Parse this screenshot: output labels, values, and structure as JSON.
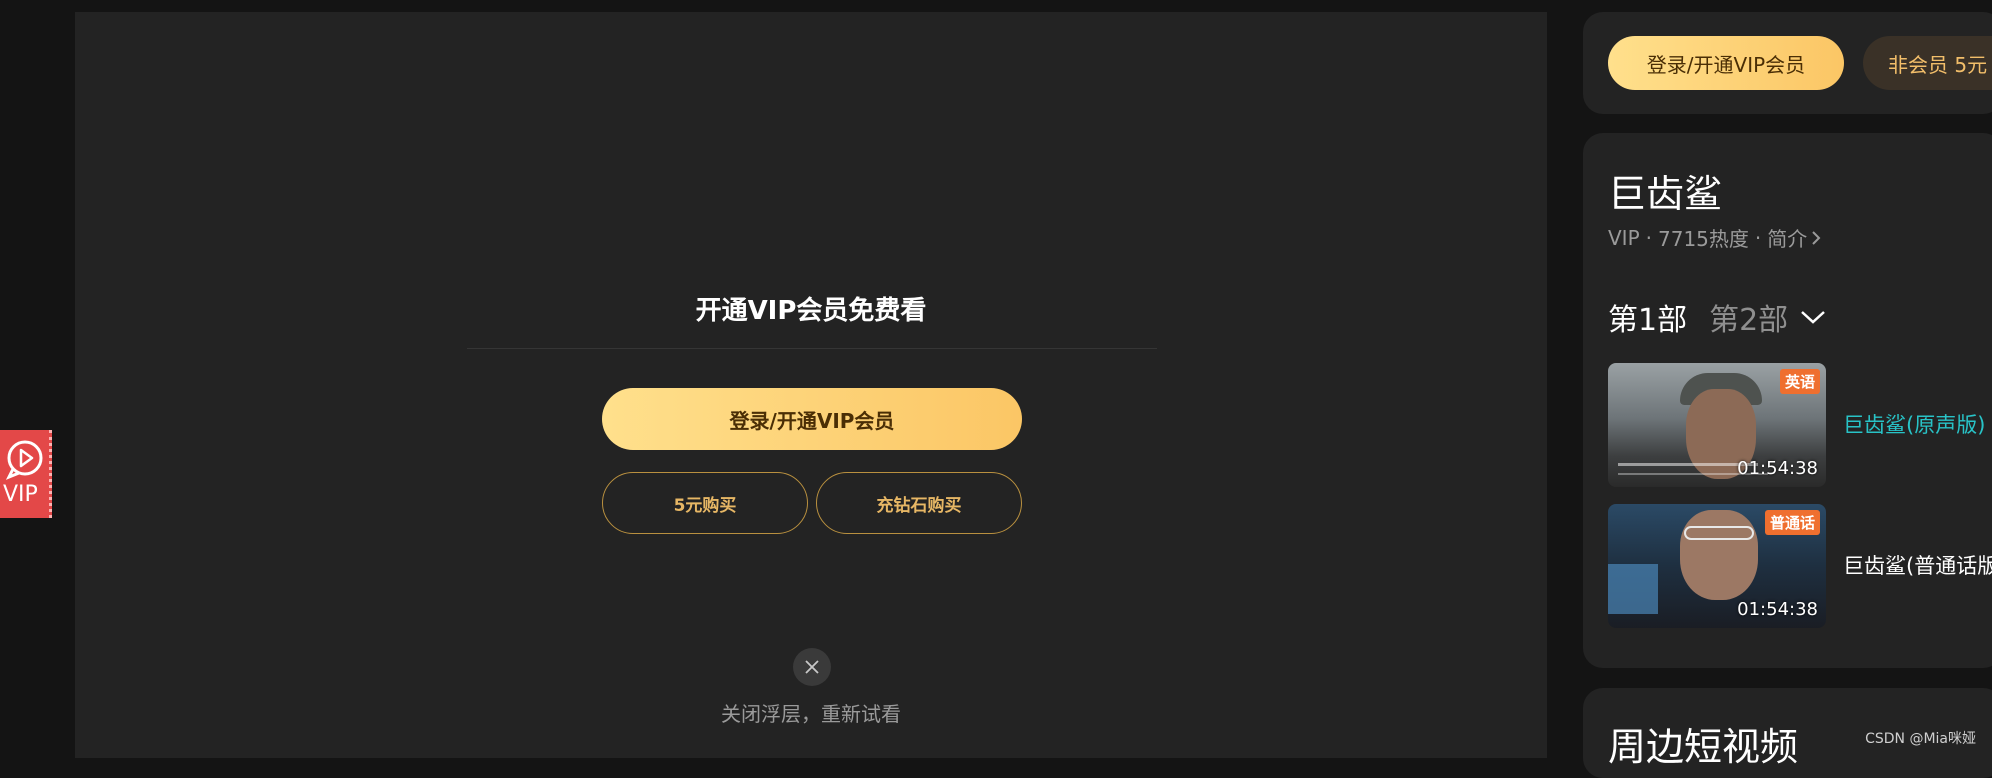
{
  "paywall": {
    "title": "开通VIP会员免费看",
    "primary_button": "登录/开通VIP会员",
    "buy_button": "5元购买",
    "diamond_button": "充钻石购买",
    "close_label": "关闭浮层，重新试看"
  },
  "vip_float": {
    "label": "VIP"
  },
  "sidebar": {
    "top_buttons": {
      "login": "登录/开通VIP会员",
      "buy": "非会员 5元"
    },
    "show": {
      "title": "巨齿鲨",
      "meta_vip": "VIP",
      "meta_sep1": "·",
      "meta_heat": "7715热度",
      "meta_sep2": "·",
      "meta_intro": "简介"
    },
    "seasons": [
      {
        "label": "第1部"
      },
      {
        "label": "第2部"
      }
    ],
    "episodes": [
      {
        "title": "巨齿鲨(原声版)",
        "badge": "英语",
        "duration": "01:54:38",
        "active": true
      },
      {
        "title": "巨齿鲨(普通话版",
        "badge": "普通话",
        "duration": "01:54:38",
        "active": false
      }
    ],
    "short_videos_title": "周边短视频"
  },
  "watermark": "CSDN @Mia咪娅",
  "colors": {
    "background": "#141414",
    "panel": "#232323",
    "gold": "#fbc665",
    "active_episode": "#28c3c7",
    "vip_red": "#e34848"
  }
}
